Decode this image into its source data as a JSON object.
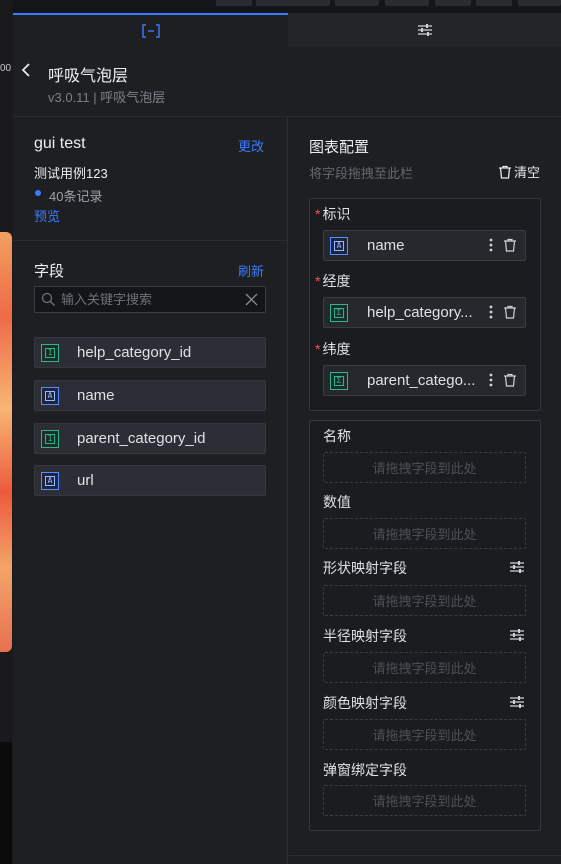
{
  "strip": {
    "label": "00"
  },
  "tabs": [
    {
      "name": "data",
      "icon": "bracket-icon",
      "active": true
    },
    {
      "name": "style",
      "icon": "sliders-icon",
      "active": false
    }
  ],
  "header": {
    "title": "呼吸气泡层",
    "subtitle": "v3.0.11 | 呼吸气泡层"
  },
  "dataset": {
    "name": "gui test",
    "change_label": "更改",
    "test_case": "测试用例123",
    "records": "40条记录",
    "preview_label": "预览"
  },
  "fields": {
    "title": "字段",
    "refresh_label": "刷新",
    "search_placeholder": "输入关键字搜索",
    "items": [
      {
        "name": "help_category_id",
        "type": "number"
      },
      {
        "name": "name",
        "type": "text"
      },
      {
        "name": "parent_category_id",
        "type": "number"
      },
      {
        "name": "url",
        "type": "text"
      }
    ]
  },
  "config": {
    "title": "图表配置",
    "hint": "将字段拖拽至此栏",
    "clear_label": "清空",
    "required": [
      {
        "label": "标识",
        "field": "name",
        "type": "text"
      },
      {
        "label": "经度",
        "field": "help_category...",
        "type": "sum"
      },
      {
        "label": "纬度",
        "field": "parent_catego...",
        "type": "sum"
      }
    ],
    "optional": [
      {
        "label": "名称",
        "placeholder": "请拖拽字段到此处",
        "has_settings": false
      },
      {
        "label": "数值",
        "placeholder": "请拖拽字段到此处",
        "has_settings": false
      },
      {
        "label": "形状映射字段",
        "placeholder": "请拖拽字段到此处",
        "has_settings": true
      },
      {
        "label": "半径映射字段",
        "placeholder": "请拖拽字段到此处",
        "has_settings": true
      },
      {
        "label": "颜色映射字段",
        "placeholder": "请拖拽字段到此处",
        "has_settings": true
      },
      {
        "label": "弹窗绑定字段",
        "placeholder": "请拖拽字段到此处",
        "has_settings": false
      }
    ]
  },
  "colors": {
    "accent": "#3d7bff",
    "required_star": "#ff4d4f",
    "number_icon": "#36b28a",
    "text_icon": "#5b8cff"
  }
}
